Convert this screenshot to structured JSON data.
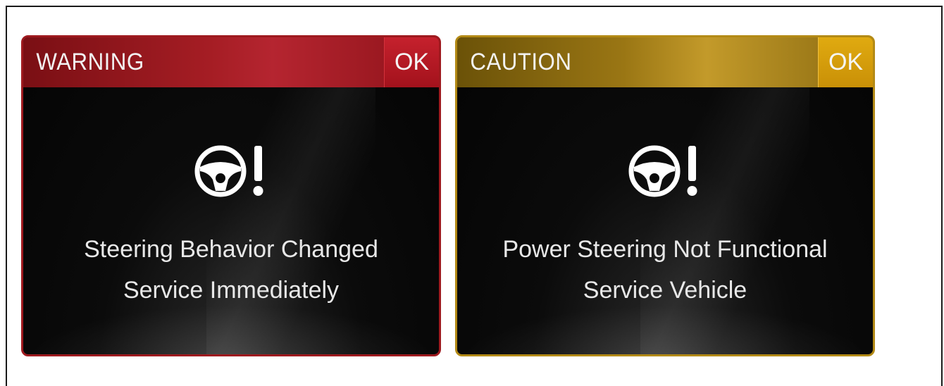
{
  "warning_panel": {
    "title": "WARNING",
    "ok_label": "OK",
    "icon": "steering-warning-icon",
    "message_line1": "Steering Behavior Changed",
    "message_line2": "Service Immediately",
    "accent_color": "#a51d24"
  },
  "caution_panel": {
    "title": "CAUTION",
    "ok_label": "OK",
    "icon": "steering-warning-icon",
    "message_line1": "Power Steering Not Functional",
    "message_line2": "Service Vehicle",
    "accent_color": "#c39a2a"
  }
}
